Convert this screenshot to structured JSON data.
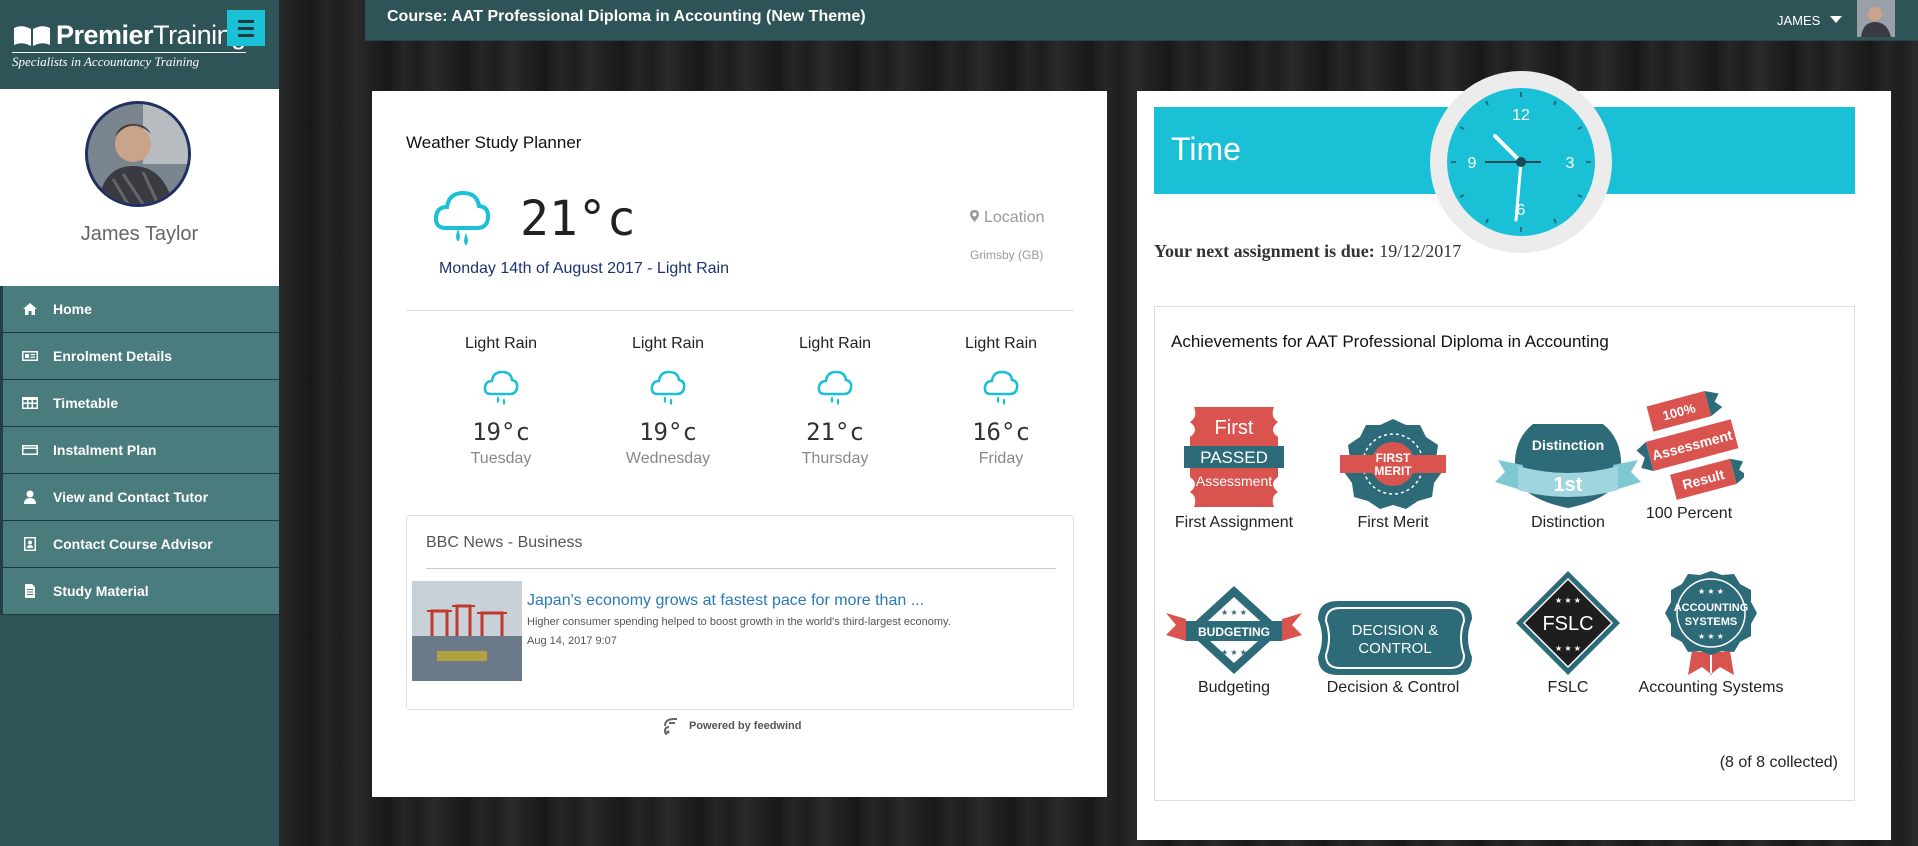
{
  "brand": {
    "name_bold": "Premier",
    "name_thin": "Training",
    "tagline": "Specialists in Accountancy Training"
  },
  "profile": {
    "name": "James Taylor"
  },
  "nav": {
    "items": [
      {
        "label": "Home",
        "icon": "home-icon"
      },
      {
        "label": "Enrolment Details",
        "icon": "id-card-icon"
      },
      {
        "label": "Timetable",
        "icon": "table-icon"
      },
      {
        "label": "Instalment Plan",
        "icon": "credit-card-icon"
      },
      {
        "label": "View and Contact Tutor",
        "icon": "user-icon"
      },
      {
        "label": "Contact Course Advisor",
        "icon": "address-book-icon"
      },
      {
        "label": "Study Material",
        "icon": "document-icon"
      }
    ]
  },
  "header": {
    "course_title": "Course: AAT Professional Diploma in Accounting (New Theme)",
    "user_name": "JAMES"
  },
  "weather": {
    "title": "Weather Study Planner",
    "temp": "21°c",
    "date_line": "Monday 14th of August 2017 - Light Rain",
    "location_label": "Location",
    "city": "Grimsby  (GB)",
    "forecast": [
      {
        "cond": "Light Rain",
        "temp": "19°c",
        "day": "Tuesday"
      },
      {
        "cond": "Light Rain",
        "temp": "19°c",
        "day": "Wednesday"
      },
      {
        "cond": "Light Rain",
        "temp": "21°c",
        "day": "Thursday"
      },
      {
        "cond": "Light Rain",
        "temp": "16°c",
        "day": "Friday"
      }
    ],
    "accent_color": "#1ac0d6"
  },
  "news": {
    "source": "BBC News - Business",
    "headline": "Japan's economy grows at fastest pace for more than ...",
    "description": "Higher consumer spending helped to boost growth in the world's third-largest economy.",
    "time": "Aug 14, 2017 9:07",
    "powered_by": "Powered by feedwind"
  },
  "time_panel": {
    "title": "Time",
    "clock_numbers": [
      "12",
      "3",
      "6",
      "9"
    ],
    "assignment_label": "Your next assignment is due:",
    "assignment_date": "19/12/2017"
  },
  "achievements": {
    "title": "Achievements for AAT Professional Diploma in Accounting",
    "badges": [
      {
        "label": "First Assignment",
        "art": [
          "First",
          "PASSED",
          "Assessment"
        ]
      },
      {
        "label": "First Merit",
        "art": [
          "FIRST",
          "MERIT"
        ]
      },
      {
        "label": "Distinction",
        "art": [
          "Distinction",
          "1st"
        ]
      },
      {
        "label": "100 Percent",
        "art": [
          "100%",
          "Assessment",
          "Result"
        ]
      },
      {
        "label": "Budgeting",
        "art": [
          "BUDGETING"
        ]
      },
      {
        "label": "Decision & Control",
        "art": [
          "DECISION &",
          "CONTROL"
        ]
      },
      {
        "label": "FSLC",
        "art": [
          "FSLC"
        ]
      },
      {
        "label": "Accounting Systems",
        "art": [
          "ACCOUNTING",
          "SYSTEMS"
        ]
      }
    ],
    "count": "(8 of 8 collected)"
  },
  "colors": {
    "sidebar": "#2f5457",
    "nav_item": "#4a7b7d",
    "accent": "#1ac0d6",
    "badge_teal": "#2e6b78",
    "badge_red": "#d9534f"
  }
}
